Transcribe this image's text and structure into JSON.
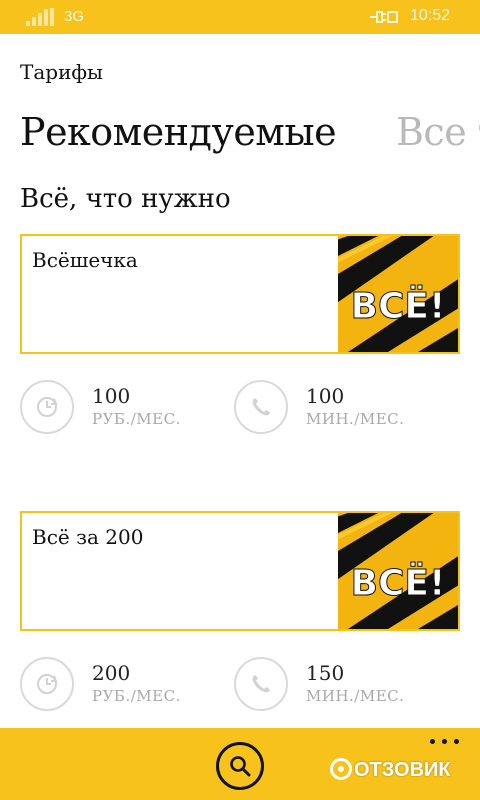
{
  "status_bar": {
    "network": "3G",
    "time": "10:52"
  },
  "header": {
    "app_title": "Тарифы"
  },
  "pivot": {
    "active": "Рекомендуемые",
    "next": "Все т"
  },
  "section": {
    "title": "Всё, что нужно"
  },
  "tariffs": [
    {
      "name": "Всёшечка",
      "banner_text": "ВСЁ!",
      "price_value": "100",
      "price_unit": "РУБ./МЕС.",
      "minutes_value": "100",
      "minutes_unit": "МИН./МЕС."
    },
    {
      "name": "Всё за 200",
      "banner_text": "ВСЁ!",
      "price_value": "200",
      "price_unit": "РУБ./МЕС.",
      "minutes_value": "150",
      "minutes_unit": "МИН./МЕС."
    }
  ],
  "watermark": {
    "text": "ОТЗОВИК"
  },
  "icons": {
    "price": "clock-refresh-icon",
    "minutes": "phone-icon",
    "search": "search-icon",
    "more": "more-dots-icon"
  },
  "colors": {
    "accent": "#f6c21b",
    "card_border": "#f5c21a",
    "muted": "#a9a9a9"
  }
}
